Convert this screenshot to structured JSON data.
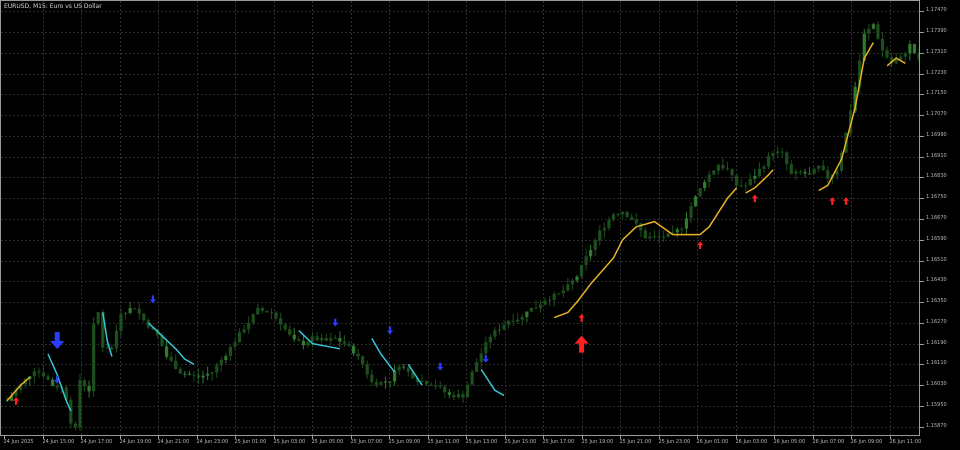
{
  "window": {
    "title": "EURUSD, M15:  Euro vs US Dollar"
  },
  "colors": {
    "background": "#000000",
    "grid": "#2e2e2e",
    "candle": "#1d4f1d",
    "candle_bright": "#2f7a2f",
    "trend_down": "#35c6d6",
    "trend_up": "#e8b227",
    "arrow_buy": "#ff2020",
    "arrow_sell": "#2a3cff",
    "axis_text": "#b8b8b8"
  },
  "price_axis": {
    "labels": [
      "1.17470",
      "1.17390",
      "1.17310",
      "1.17230",
      "1.17150",
      "1.17070",
      "1.16990",
      "1.16910",
      "1.16830",
      "1.16750",
      "1.16670",
      "1.16590",
      "1.16510",
      "1.16430",
      "1.16350",
      "1.16270",
      "1.16190",
      "1.16110",
      "1.16030",
      "1.15950",
      "1.15870"
    ]
  },
  "time_axis": {
    "labels": [
      "24 Jun 2025",
      "24 Jun 15:00",
      "24 Jun 17:00",
      "24 Jun 19:00",
      "24 Jun 21:00",
      "24 Jun 23:00",
      "25 Jun 01:00",
      "25 Jun 03:00",
      "25 Jun 05:00",
      "25 Jun 07:00",
      "25 Jun 09:00",
      "25 Jun 11:00",
      "25 Jun 13:00",
      "25 Jun 15:00",
      "25 Jun 17:00",
      "25 Jun 19:00",
      "25 Jun 21:00",
      "25 Jun 23:00",
      "26 Jun 01:00",
      "26 Jun 03:00",
      "26 Jun 05:00",
      "26 Jun 07:00",
      "26 Jun 09:00",
      "26 Jun 11:00"
    ]
  },
  "chart_data": {
    "type": "line",
    "symbol": "EURUSD",
    "timeframe": "M15",
    "ylim": [
      1.1583,
      1.1751
    ],
    "grid": true,
    "y_ticks": [
      1.1747,
      1.1739,
      1.1731,
      1.1723,
      1.1715,
      1.1707,
      1.1699,
      1.1691,
      1.1683,
      1.1675,
      1.1667,
      1.1659,
      1.1651,
      1.1643,
      1.1635,
      1.1627,
      1.1619,
      1.1611,
      1.1603,
      1.1595,
      1.1587
    ],
    "price_path": [
      [
        0,
        1.1597
      ],
      [
        3,
        1.1603
      ],
      [
        6,
        1.1609
      ],
      [
        8,
        1.1607
      ],
      [
        10,
        1.1603
      ],
      [
        12,
        1.1602
      ],
      [
        13,
        1.1598
      ],
      [
        14,
        1.1589
      ],
      [
        15,
        1.1586
      ],
      [
        16,
        1.1605
      ],
      [
        18,
        1.1601
      ],
      [
        19,
        1.1626
      ],
      [
        20,
        1.1631
      ],
      [
        21,
        1.1618
      ],
      [
        23,
        1.1617
      ],
      [
        25,
        1.1631
      ],
      [
        28,
        1.1633
      ],
      [
        30,
        1.1628
      ],
      [
        33,
        1.1622
      ],
      [
        35,
        1.1614
      ],
      [
        38,
        1.1608
      ],
      [
        42,
        1.1606
      ],
      [
        45,
        1.1608
      ],
      [
        48,
        1.1615
      ],
      [
        52,
        1.1625
      ],
      [
        55,
        1.1632
      ],
      [
        58,
        1.1631
      ],
      [
        60,
        1.1627
      ],
      [
        62,
        1.1622
      ],
      [
        63,
        1.162
      ],
      [
        65,
        1.1619
      ],
      [
        67,
        1.1621
      ],
      [
        70,
        1.162
      ],
      [
        72,
        1.1621
      ],
      [
        74,
        1.1619
      ],
      [
        76,
        1.1616
      ],
      [
        78,
        1.1611
      ],
      [
        80,
        1.1604
      ],
      [
        82,
        1.1604
      ],
      [
        84,
        1.1605
      ],
      [
        86,
        1.1611
      ],
      [
        88,
        1.1608
      ],
      [
        90,
        1.1605
      ],
      [
        94,
        1.1603
      ],
      [
        97,
        1.1599
      ],
      [
        100,
        1.1599
      ],
      [
        103,
        1.1612
      ],
      [
        106,
        1.1622
      ],
      [
        110,
        1.1628
      ],
      [
        113,
        1.1629
      ],
      [
        114,
        1.1632
      ],
      [
        116,
        1.1633
      ],
      [
        118,
        1.1636
      ],
      [
        121,
        1.1638
      ],
      [
        123,
        1.1641
      ],
      [
        125,
        1.1645
      ],
      [
        127,
        1.1652
      ],
      [
        130,
        1.1662
      ],
      [
        133,
        1.1669
      ],
      [
        135,
        1.167
      ],
      [
        137,
        1.1667
      ],
      [
        140,
        1.166
      ],
      [
        143,
        1.166
      ],
      [
        146,
        1.1661
      ],
      [
        148,
        1.1664
      ],
      [
        150,
        1.1672
      ],
      [
        153,
        1.1682
      ],
      [
        156,
        1.1688
      ],
      [
        158,
        1.1686
      ],
      [
        160,
        1.168
      ],
      [
        162,
        1.168
      ],
      [
        164,
        1.1684
      ],
      [
        166,
        1.1688
      ],
      [
        168,
        1.1693
      ],
      [
        170,
        1.1692
      ],
      [
        172,
        1.1684
      ],
      [
        174,
        1.1685
      ],
      [
        176,
        1.1684
      ],
      [
        178,
        1.1687
      ],
      [
        180,
        1.1683
      ],
      [
        182,
        1.1686
      ],
      [
        184,
        1.17
      ],
      [
        186,
        1.1718
      ],
      [
        188,
        1.1738
      ],
      [
        190,
        1.1742
      ],
      [
        192,
        1.1732
      ],
      [
        194,
        1.1727
      ],
      [
        196,
        1.1729
      ],
      [
        198,
        1.1734
      ],
      [
        200,
        1.1728
      ]
    ],
    "trend_segments": [
      {
        "color": "down",
        "points": [
          [
            9,
            1.1615
          ],
          [
            11,
            1.1607
          ],
          [
            13,
            1.1597
          ],
          [
            14,
            1.1593
          ]
        ]
      },
      {
        "color": "down",
        "points": [
          [
            21,
            1.1631
          ],
          [
            22,
            1.162
          ],
          [
            23,
            1.1614
          ]
        ]
      },
      {
        "color": "down",
        "points": [
          [
            31,
            1.1627
          ],
          [
            34,
            1.1622
          ],
          [
            37,
            1.1617
          ],
          [
            39,
            1.1613
          ],
          [
            41,
            1.1611
          ]
        ]
      },
      {
        "color": "down",
        "points": [
          [
            64,
            1.1624
          ],
          [
            67,
            1.1619
          ],
          [
            70,
            1.1618
          ],
          [
            73,
            1.1617
          ]
        ]
      },
      {
        "color": "down",
        "points": [
          [
            80,
            1.1621
          ],
          [
            82,
            1.1615
          ],
          [
            85,
            1.1608
          ]
        ]
      },
      {
        "color": "down",
        "points": [
          [
            88,
            1.1611
          ],
          [
            91,
            1.1603
          ]
        ]
      },
      {
        "color": "down",
        "points": [
          [
            104,
            1.1609
          ],
          [
            107,
            1.1601
          ],
          [
            109,
            1.1599
          ]
        ]
      },
      {
        "color": "up",
        "points": [
          [
            0,
            1.1597
          ],
          [
            3,
            1.1603
          ],
          [
            5,
            1.1606
          ]
        ]
      },
      {
        "color": "up",
        "points": [
          [
            120,
            1.1629
          ],
          [
            123,
            1.1631
          ],
          [
            125,
            1.1635
          ],
          [
            128,
            1.1642
          ],
          [
            133,
            1.1652
          ],
          [
            135,
            1.1659
          ],
          [
            138,
            1.1664
          ],
          [
            142,
            1.1666
          ],
          [
            146,
            1.1661
          ],
          [
            152,
            1.1661
          ],
          [
            154,
            1.1664
          ],
          [
            158,
            1.1675
          ],
          [
            160,
            1.1679
          ]
        ]
      },
      {
        "color": "up",
        "points": [
          [
            162,
            1.1677
          ],
          [
            164,
            1.1679
          ],
          [
            167,
            1.1684
          ],
          [
            168,
            1.1686
          ]
        ]
      },
      {
        "color": "up",
        "points": [
          [
            178,
            1.1678
          ],
          [
            180,
            1.168
          ],
          [
            183,
            1.169
          ],
          [
            186,
            1.171
          ],
          [
            188,
            1.1729
          ],
          [
            190,
            1.1735
          ]
        ]
      },
      {
        "color": "up",
        "points": [
          [
            193,
            1.1726
          ],
          [
            195,
            1.1729
          ],
          [
            197,
            1.1727
          ]
        ]
      }
    ],
    "arrows": [
      {
        "type": "buy",
        "size": "small",
        "x": 2,
        "y": 1.1597
      },
      {
        "type": "sell",
        "size": "big",
        "x": 11,
        "y": 1.162
      },
      {
        "type": "sell",
        "size": "small",
        "x": 11,
        "y": 1.1605
      },
      {
        "type": "sell",
        "size": "small",
        "x": 32,
        "y": 1.1636
      },
      {
        "type": "sell",
        "size": "small",
        "x": 72,
        "y": 1.1627
      },
      {
        "type": "sell",
        "size": "small",
        "x": 84,
        "y": 1.1624
      },
      {
        "type": "sell",
        "size": "small",
        "x": 95,
        "y": 1.161
      },
      {
        "type": "sell",
        "size": "small",
        "x": 105,
        "y": 1.1613
      },
      {
        "type": "buy",
        "size": "small",
        "x": 126,
        "y": 1.1629
      },
      {
        "type": "buy",
        "size": "big",
        "x": 126,
        "y": 1.1619
      },
      {
        "type": "buy",
        "size": "small",
        "x": 152,
        "y": 1.1657
      },
      {
        "type": "buy",
        "size": "small",
        "x": 164,
        "y": 1.1675
      },
      {
        "type": "buy",
        "size": "small",
        "x": 181,
        "y": 1.1674
      },
      {
        "type": "buy",
        "size": "small",
        "x": 184,
        "y": 1.1674
      }
    ]
  }
}
